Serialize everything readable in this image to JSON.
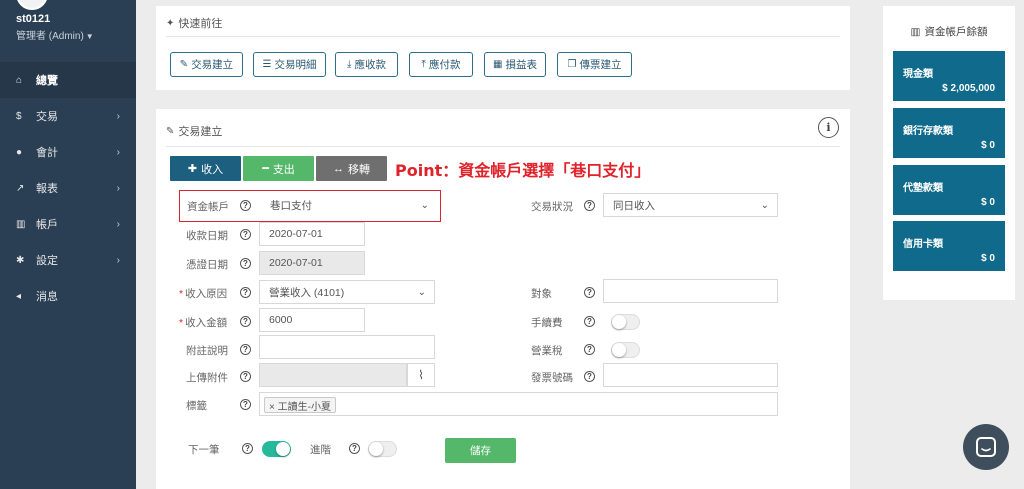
{
  "user": {
    "name": "st0121",
    "role": "管理者 (Admin)"
  },
  "nav": [
    {
      "label": "總覽",
      "icon": "home-icon"
    },
    {
      "label": "交易",
      "icon": "dollar-icon"
    },
    {
      "label": "會計",
      "icon": "user-icon"
    },
    {
      "label": "報表",
      "icon": "chart-icon"
    },
    {
      "label": "帳戶",
      "icon": "bank-icon"
    },
    {
      "label": "設定",
      "icon": "gear-icon"
    },
    {
      "label": "消息",
      "icon": "megaphone-icon"
    }
  ],
  "quick": {
    "title": "快速前往",
    "buttons": [
      "交易建立",
      "交易明細",
      "應收款",
      "應付款",
      "損益表",
      "傳票建立"
    ]
  },
  "form": {
    "title": "交易建立",
    "tabs": {
      "income": "收入",
      "expense": "支出",
      "transfer": "移轉"
    },
    "note": "Point：資金帳戶選擇「巷口支付」",
    "account": {
      "label": "資金帳戶",
      "value": "巷口支付"
    },
    "trade_status": {
      "label": "交易狀況",
      "value": "同日收入"
    },
    "receive_date": {
      "label": "收款日期",
      "value": "2020-07-01"
    },
    "voucher_date": {
      "label": "憑證日期",
      "value": "2020-07-01"
    },
    "reason": {
      "label": "收入原因",
      "value": "營業收入 (4101)"
    },
    "target": {
      "label": "對象",
      "value": ""
    },
    "amount": {
      "label": "收入金額",
      "value": "6000"
    },
    "fee": {
      "label": "手續費"
    },
    "remark": {
      "label": "附註說明",
      "value": ""
    },
    "tax": {
      "label": "營業稅"
    },
    "attachment": {
      "label": "上傳附件"
    },
    "invoice": {
      "label": "發票號碼",
      "value": ""
    },
    "tags": {
      "label": "標籤",
      "chip": "× 工讀生-小夏"
    },
    "next": {
      "label": "下一筆"
    },
    "advanced": {
      "label": "進階"
    },
    "save": "儲存"
  },
  "balance": {
    "title": "資金帳戶餘額",
    "cards": [
      {
        "name": "現金類",
        "value": "$ 2,005,000"
      },
      {
        "name": "銀行存款類",
        "value": "$ 0"
      },
      {
        "name": "代墊款類",
        "value": "$ 0"
      },
      {
        "name": "信用卡類",
        "value": "$ 0"
      }
    ]
  },
  "colors": {
    "sidebar": "#2a3f54",
    "primary": "#1d5f7f",
    "success": "#26b99a",
    "card": "#0f6a8b",
    "highlight": "#d9262e"
  }
}
